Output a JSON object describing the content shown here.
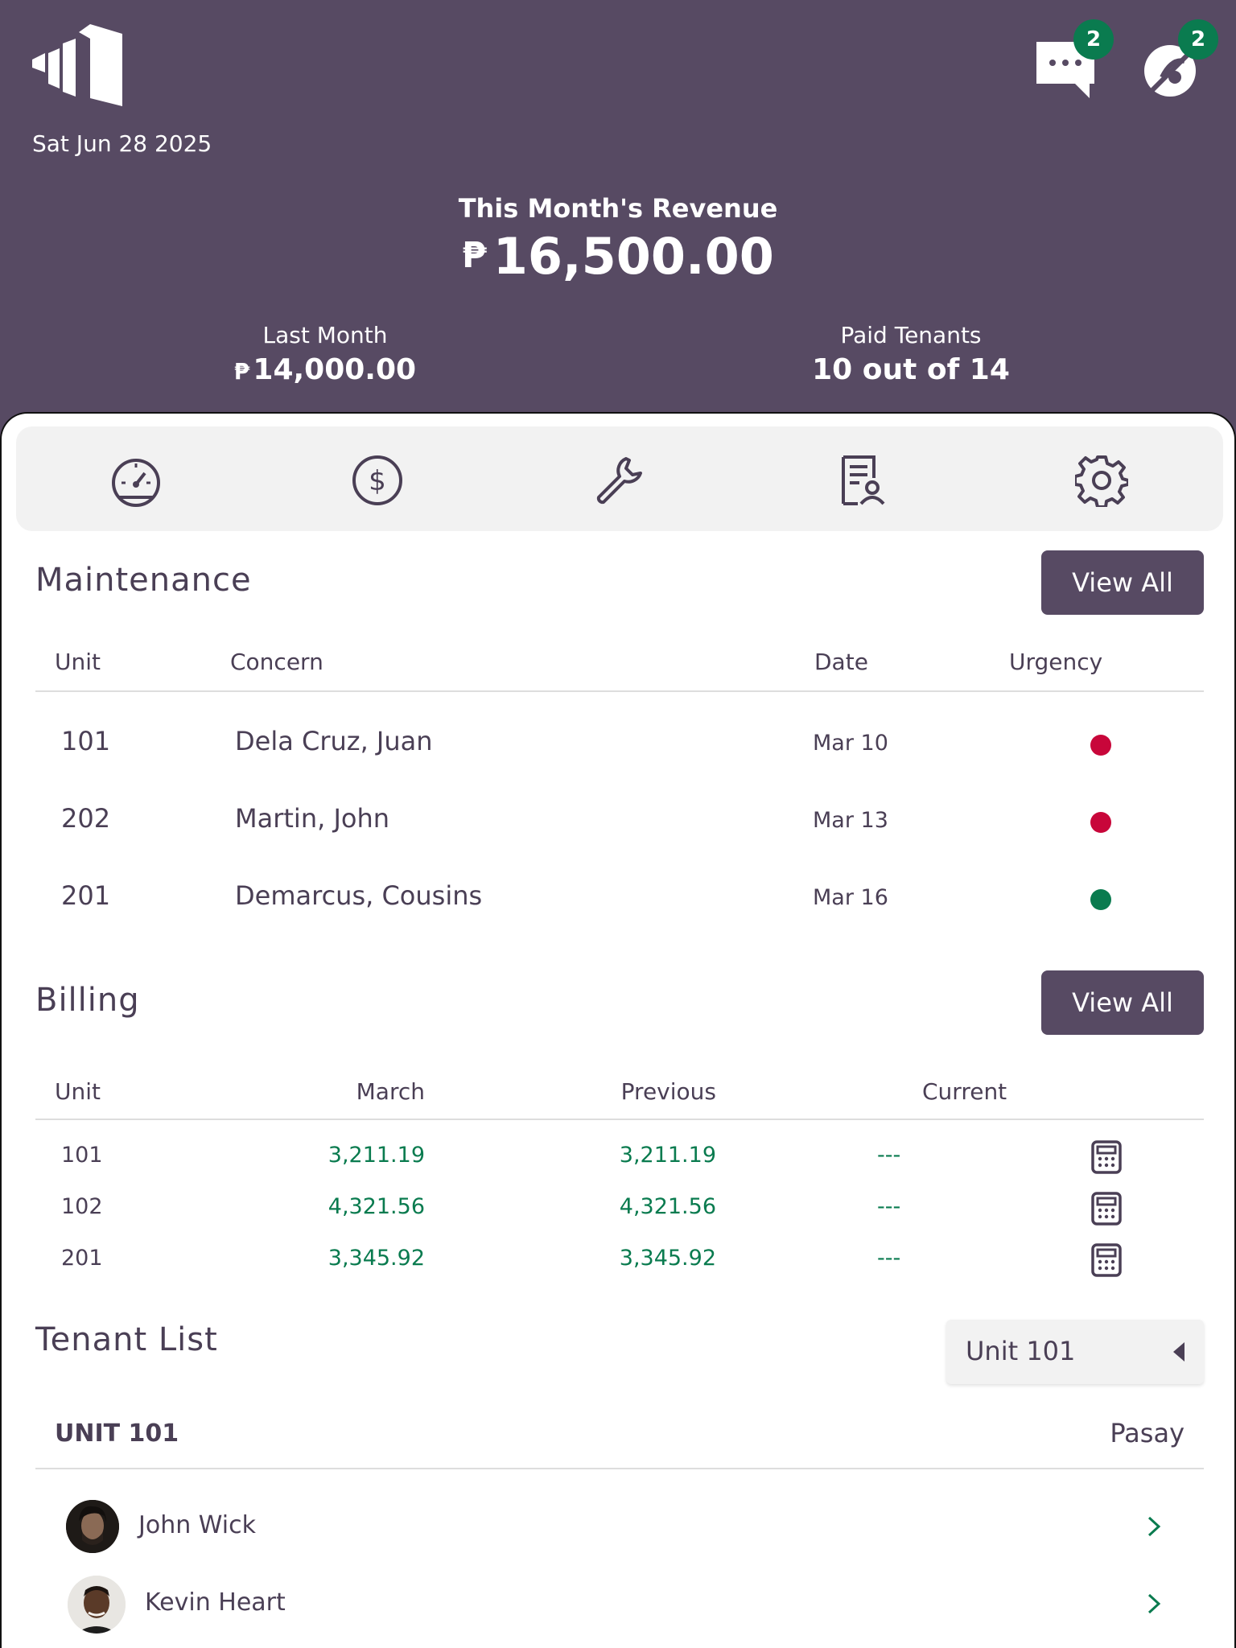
{
  "header": {
    "date": "Sat Jun 28 2025",
    "messages_badge": "2",
    "alerts_badge": "2",
    "revenue_title": "This Month's Revenue",
    "currency_symbol": "₱",
    "revenue_value": "16,500.00",
    "last_month_label": "Last Month",
    "last_month_value": "14,000.00",
    "paid_tenants_label": "Paid Tenants",
    "paid_tenants_value": "10 out of 14"
  },
  "nav": {
    "icons": [
      "dashboard-gauge-icon",
      "dollar-icon",
      "wrench-icon",
      "document-user-icon",
      "gear-icon"
    ]
  },
  "maintenance": {
    "title": "Maintenance",
    "view_all": "View All",
    "columns": [
      "Unit",
      "Concern",
      "Date",
      "Urgency"
    ],
    "rows": [
      {
        "unit": "101",
        "concern": "Dela Cruz, Juan",
        "date": "Mar 10",
        "urgency": "high"
      },
      {
        "unit": "202",
        "concern": "Martin, John",
        "date": "Mar 13",
        "urgency": "high"
      },
      {
        "unit": "201",
        "concern": "Demarcus, Cousins",
        "date": "Mar 16",
        "urgency": "low"
      }
    ],
    "colors": {
      "high": "#c8063a",
      "low": "#0a7b4f"
    }
  },
  "billing": {
    "title": "Billing",
    "view_all": "View All",
    "columns": [
      "Unit",
      "March",
      "Previous",
      "Current"
    ],
    "rows": [
      {
        "unit": "101",
        "march": "3,211.19",
        "previous": "3,211.19",
        "current": "---"
      },
      {
        "unit": "102",
        "march": "4,321.56",
        "previous": "4,321.56",
        "current": "---"
      },
      {
        "unit": "201",
        "march": "3,345.92",
        "previous": "3,345.92",
        "current": "---"
      }
    ]
  },
  "tenants": {
    "title": "Tenant List",
    "dropdown_value": "Unit 101",
    "unit_label": "UNIT 101",
    "location": "Pasay",
    "people": [
      {
        "name": "John Wick"
      },
      {
        "name": "Kevin Heart"
      }
    ]
  }
}
